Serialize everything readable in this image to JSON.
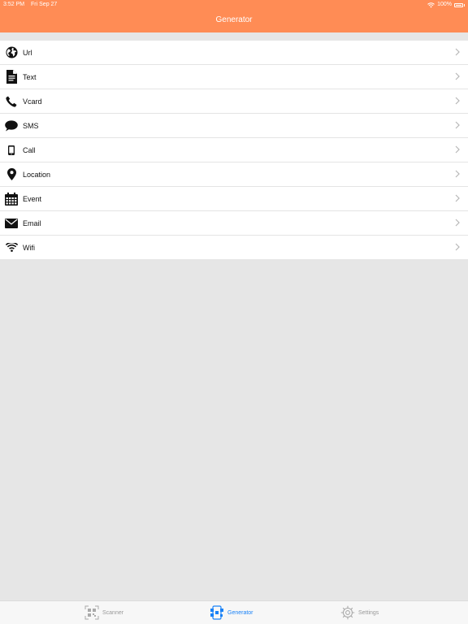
{
  "status": {
    "time": "3:52 PM",
    "date": "Fri Sep 27",
    "battery": "100%"
  },
  "header": {
    "title": "Generator"
  },
  "items": [
    {
      "label": "Url",
      "icon": "globe-icon"
    },
    {
      "label": "Text",
      "icon": "document-icon"
    },
    {
      "label": "Vcard",
      "icon": "phone-handset-icon"
    },
    {
      "label": "SMS",
      "icon": "chat-bubble-icon"
    },
    {
      "label": "Call",
      "icon": "mobile-phone-icon"
    },
    {
      "label": "Location",
      "icon": "map-pin-icon"
    },
    {
      "label": "Event",
      "icon": "calendar-icon"
    },
    {
      "label": "Email",
      "icon": "envelope-icon"
    },
    {
      "label": "Wifi",
      "icon": "wifi-icon"
    }
  ],
  "tabs": [
    {
      "label": "Scanner",
      "icon": "qr-scan-icon"
    },
    {
      "label": "Generator",
      "icon": "qr-generator-icon",
      "active": true
    },
    {
      "label": "Settings",
      "icon": "gear-icon"
    }
  ],
  "colors": {
    "header": "#ff8c55",
    "active_tab": "#1a82f7",
    "inactive_tab": "#999999",
    "background": "#e6e6e6"
  }
}
